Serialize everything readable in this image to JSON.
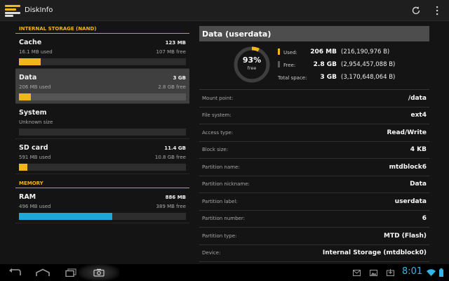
{
  "app": {
    "title": "DiskInfo",
    "icon": "diskinfo-logo-icon"
  },
  "actionbar": {
    "refresh_icon": "refresh-icon",
    "overflow_icon": "overflow-menu-icon"
  },
  "colors": {
    "accent": "#f2b61a",
    "used_bar": "#f2b61a",
    "memory_bar": "#1ea7d9",
    "clock": "#33b5e5"
  },
  "left": {
    "internal_header": "INTERNAL STORAGE (NAND)",
    "memory_header": "MEMORY",
    "internal_items": [
      {
        "name": "Cache",
        "total": "123 MB",
        "used": "16.1 MB used",
        "free": "107 MB free",
        "used_fraction": 0.13,
        "selected": false
      },
      {
        "name": "Data",
        "total": "3 GB",
        "used": "206 MB used",
        "free": "2.8 GB free",
        "used_fraction": 0.07,
        "selected": true
      },
      {
        "name": "System",
        "total": "",
        "used": "Unknown size",
        "free": "",
        "used_fraction": 0,
        "selected": false
      },
      {
        "name": "SD card",
        "total": "11.4 GB",
        "used": "591 MB used",
        "free": "10.8 GB free",
        "used_fraction": 0.05,
        "selected": false
      }
    ],
    "memory_items": [
      {
        "name": "RAM",
        "total": "886 MB",
        "used": "496 MB used",
        "free": "389 MB free",
        "used_fraction": 0.56
      }
    ]
  },
  "detail": {
    "title": "Data (userdata)",
    "donut": {
      "percent_label": "93%",
      "free_label": "free",
      "free_fraction": 0.93
    },
    "legend": [
      {
        "label": "Used:",
        "value": "206 MB",
        "bytes": "(216,190,976 B)",
        "swatch": "#f2b61a"
      },
      {
        "label": "Free:",
        "value": "2.8 GB",
        "bytes": "(2,954,457,088 B)",
        "swatch": "#5a5a5a"
      },
      {
        "label": "Total space:",
        "value": "3 GB",
        "bytes": "(3,170,648,064 B)",
        "swatch": ""
      }
    ],
    "properties": [
      {
        "label": "Mount point:",
        "value": "/data"
      },
      {
        "label": "File system:",
        "value": "ext4"
      },
      {
        "label": "Access type:",
        "value": "Read/Write"
      },
      {
        "label": "Block size:",
        "value": "4 KB"
      },
      {
        "label": "Partition name:",
        "value": "mtdblock6"
      },
      {
        "label": "Partition nickname:",
        "value": "Data"
      },
      {
        "label": "Partition label:",
        "value": "userdata"
      },
      {
        "label": "Partition number:",
        "value": "6"
      },
      {
        "label": "Partition type:",
        "value": "MTD (Flash)"
      },
      {
        "label": "Device:",
        "value": "Internal Storage (mtdblock0)"
      }
    ]
  },
  "navbar": {
    "buttons": [
      "back-icon",
      "home-icon",
      "recent-apps-icon",
      "screenshot-icon"
    ],
    "status_icons": [
      "gmail-notification-icon",
      "gallery-notification-icon",
      "download-notification-icon"
    ],
    "clock": "8:01"
  }
}
